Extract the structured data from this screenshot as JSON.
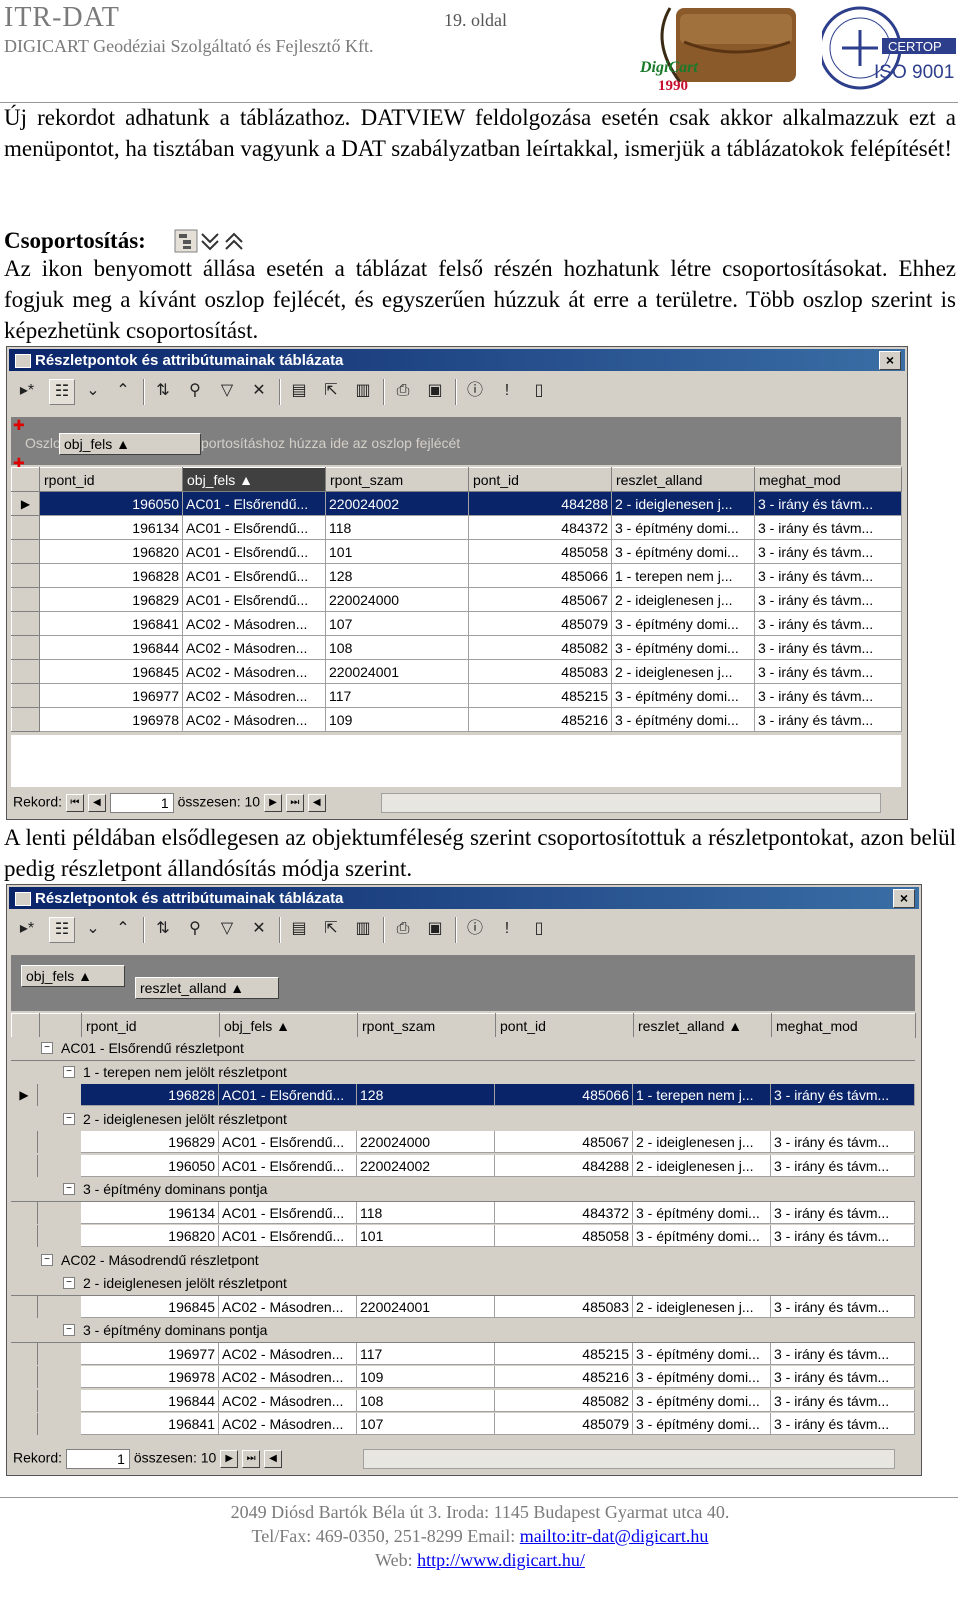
{
  "header": {
    "title": "ITR-DAT",
    "company": "DIGICART Geodéziai Szolgáltató és Fejlesztő Kft.",
    "page": "19. oldal",
    "logo_text": "DigiCart",
    "logo_year": "1990",
    "iso_text": "ISO 9001",
    "certop_text": "CERTOP"
  },
  "intro_paragraph": "Új rekordot adhatunk a táblázathoz. DATVIEW feldolgozása esetén csak akkor alkalmazzuk ezt a menüpontot, ha tisztában vagyunk a DAT szabályzatban leírtakkal, ismerjük a táblázatokok felépítését!",
  "grouping": {
    "heading": "Csoportosítás:",
    "paragraph": "Az ikon benyomott állása esetén a táblázat felső részén hozhatunk létre csoportosításokat. Ehhez fogjuk meg a kívánt oszlop fejlécét, és egyszerűen húzzuk át erre a területre. Több oszlop szerint is képezhetünk csoportosítást."
  },
  "window1": {
    "title": "Részletpontok és attribútumainak táblázata",
    "close": "×",
    "group_hint_prefix": "Oszlo",
    "group_hint_suffix": "portosításhoz húzza ide az oszlop fejlécét",
    "drag_chip": "obj_fels ▲",
    "columns": [
      "rpont_id",
      "obj_fels ▲",
      "rpont_szam",
      "pont_id",
      "reszlet_alland",
      "meghat_mod"
    ],
    "rows": [
      [
        "196050",
        "AC01 - Elsőrendű...",
        "220024002",
        "484288",
        "2 - ideiglenesen j...",
        "3 - irány és távm..."
      ],
      [
        "196134",
        "AC01 - Elsőrendű...",
        "118",
        "484372",
        "3 - építmény domi...",
        "3 - irány és távm..."
      ],
      [
        "196820",
        "AC01 - Elsőrendű...",
        "101",
        "485058",
        "3 - építmény domi...",
        "3 - irány és távm..."
      ],
      [
        "196828",
        "AC01 - Elsőrendű...",
        "128",
        "485066",
        "1 - terepen nem j...",
        "3 - irány és távm..."
      ],
      [
        "196829",
        "AC01 - Elsőrendű...",
        "220024000",
        "485067",
        "2 - ideiglenesen j...",
        "3 - irány és távm..."
      ],
      [
        "196841",
        "AC02 - Másodren...",
        "107",
        "485079",
        "3 - építmény domi...",
        "3 - irány és távm..."
      ],
      [
        "196844",
        "AC02 - Másodren...",
        "108",
        "485082",
        "3 - építmény domi...",
        "3 - irány és távm..."
      ],
      [
        "196845",
        "AC02 - Másodren...",
        "220024001",
        "485083",
        "2 - ideiglenesen j...",
        "3 - irány és távm..."
      ],
      [
        "196977",
        "AC02 - Másodren...",
        "117",
        "485215",
        "3 - építmény domi...",
        "3 - irány és távm..."
      ],
      [
        "196978",
        "AC02 - Másodren...",
        "109",
        "485216",
        "3 - építmény domi...",
        "3 - irány és távm..."
      ]
    ],
    "nav": {
      "label": "Rekord:",
      "value": "1",
      "total": "összesen: 10"
    }
  },
  "middle_paragraph": "A lenti példában elsődlegesen az objektumféleség szerint csoportosítottuk a részletpontokat, azon belül pedig részletpont állandósítás módja szerint.",
  "window2": {
    "title": "Részletpontok és attribútumainak táblázata",
    "close": "×",
    "chips": [
      "obj_fels ▲",
      "reszlet_alland ▲"
    ],
    "columns": [
      "rpont_id",
      "obj_fels ▲",
      "rpont_szam",
      "pont_id",
      "reszlet_alland ▲",
      "meghat_mod"
    ],
    "groups": {
      "g1": "AC01 - Elsőrendű részletpont",
      "g1a": "1 - terepen nem jelölt részletpont",
      "g1b": "2 - ideiglenesen jelölt részletpont",
      "g1c": "3 - építmény dominans pontja",
      "g2": "AC02 - Másodrendű részletpont",
      "g2a": "2 - ideiglenesen jelölt részletpont",
      "g2b": "3 - építmény dominans pontja"
    },
    "rows": [
      [
        "196828",
        "AC01 - Elsőrendű...",
        "128",
        "485066",
        "1 - terepen nem j...",
        "3 - irány és távm..."
      ],
      [
        "196829",
        "AC01 - Elsőrendű...",
        "220024000",
        "485067",
        "2 - ideiglenesen j...",
        "3 - irány és távm..."
      ],
      [
        "196050",
        "AC01 - Elsőrendű...",
        "220024002",
        "484288",
        "2 - ideiglenesen j...",
        "3 - irány és távm..."
      ],
      [
        "196134",
        "AC01 - Elsőrendű...",
        "118",
        "484372",
        "3 - építmény domi...",
        "3 - irány és távm..."
      ],
      [
        "196820",
        "AC01 - Elsőrendű...",
        "101",
        "485058",
        "3 - építmény domi...",
        "3 - irány és távm..."
      ],
      [
        "196845",
        "AC02 - Másodren...",
        "220024001",
        "485083",
        "2 - ideiglenesen j...",
        "3 - irány és távm..."
      ],
      [
        "196977",
        "AC02 - Másodren...",
        "117",
        "485215",
        "3 - építmény domi...",
        "3 - irány és távm..."
      ],
      [
        "196978",
        "AC02 - Másodren...",
        "109",
        "485216",
        "3 - építmény domi...",
        "3 - irány és távm..."
      ],
      [
        "196844",
        "AC02 - Másodren...",
        "108",
        "485082",
        "3 - építmény domi...",
        "3 - irány és távm..."
      ],
      [
        "196841",
        "AC02 - Másodren...",
        "107",
        "485079",
        "3 - építmény domi...",
        "3 - irány és távm..."
      ]
    ],
    "nav": {
      "label": "Rekord:",
      "value": "1",
      "total": "összesen: 10"
    }
  },
  "footer": {
    "address": "2049 Diósd Bartók Béla út 3. Iroda: 1145 Budapest Gyarmat utca 40.",
    "phone_prefix": "Tel/Fax: 469-0350, 251-8299 Email: ",
    "email_link": "mailto:itr-dat@digicart.hu",
    "web_prefix": "Web: ",
    "web_link": "http://www.digicart.hu/"
  }
}
